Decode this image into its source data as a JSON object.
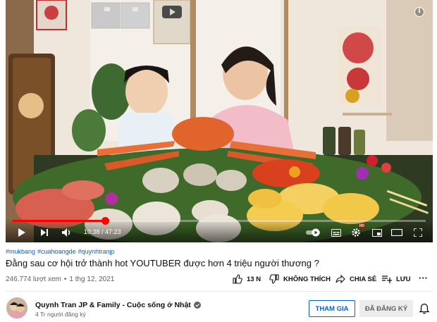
{
  "video": {
    "time_current": "10:38",
    "time_total": "47:23",
    "time_separator": " / ",
    "progress_fraction": 0.224,
    "quality_badge": "HD",
    "info_label": "i"
  },
  "hashtags": [
    "#mukbang",
    "#cuahoangde",
    "#quynhtranjp"
  ],
  "title": "Đằng sau cơ hội trở thành hot YOUTUBER được hơn 4 triệu người thương ?",
  "stats": {
    "views": "246.774 lượt xem",
    "date": "1 thg 12, 2021",
    "dot": "•"
  },
  "actions": {
    "like_count": "13 N",
    "dislike_label": "KHÔNG THÍCH",
    "share_label": "CHIA SẺ",
    "save_label": "LƯU",
    "more_label": "···"
  },
  "channel": {
    "name": "Quynh Tran JP & Family - Cuộc sống ở Nhật",
    "subscribers": "4 Tr người đăng ký",
    "join_label": "THAM GIA",
    "subscribed_label": "ĐÃ ĐĂNG KÝ"
  },
  "colors": {
    "accent_blue": "#065fd4",
    "progress_red": "#ff0000"
  },
  "icons": [
    "play-icon",
    "next-icon",
    "volume-icon",
    "autoplay-toggle-icon",
    "subtitles-icon",
    "settings-icon",
    "miniplayer-icon",
    "theater-icon",
    "fullscreen-icon",
    "like-icon",
    "dislike-icon",
    "share-icon",
    "save-icon",
    "more-icon",
    "verified-icon",
    "bell-icon"
  ]
}
